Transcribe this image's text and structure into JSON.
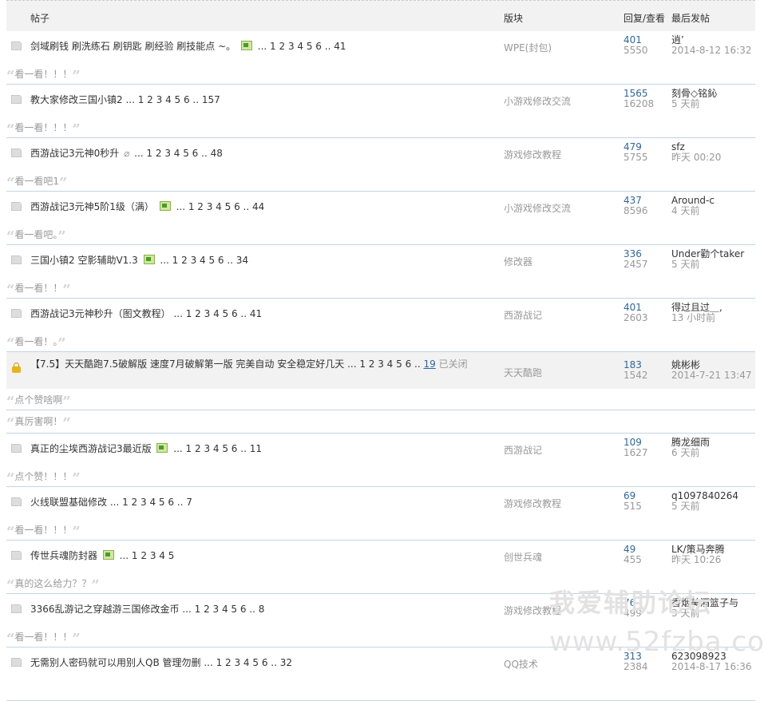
{
  "header": {
    "col_topic": "帖子",
    "col_forum": "版块",
    "col_stats": "回复/查看",
    "col_last": "最后发帖"
  },
  "threads": [
    {
      "title": "剑域刷钱 刷洗练石 刷钥匙 刷经验 刷技能点 ~。",
      "pic": true,
      "pages": "... 1 2 3 4 5 6 .. 41",
      "forum": "WPE(封包)",
      "replies": "401",
      "views": "5550",
      "last_user": "逍’",
      "last_time": "2014-8-12 16:32",
      "quote": "看一看！！！"
    },
    {
      "title": "教大家修改三国小镇2",
      "pages": "... 1 2 3 4 5 6 .. 157",
      "forum": "小游戏修改交流",
      "replies": "1565",
      "views": "16208",
      "last_user": "刻骨◇铭鈊",
      "last_time": "5 天前",
      "quote": "看一看！！！"
    },
    {
      "title": "西游战记3元神0秒升",
      "clip": true,
      "pages": "... 1 2 3 4 5 6 .. 48",
      "forum": "游戏修改教程",
      "replies": "479",
      "views": "5755",
      "last_user": "sfz",
      "last_time": "昨天 00:20",
      "quote": "看一看吧1"
    },
    {
      "title": "西游战记3元神5阶1级（满）",
      "pic": true,
      "pages": "... 1 2 3 4 5 6 .. 44",
      "forum": "小游戏修改交流",
      "replies": "437",
      "views": "8596",
      "last_user": "Around-c",
      "last_time": "4 天前",
      "quote": "看一看吧。"
    },
    {
      "title": "三国小镇2 空影辅助V1.3",
      "pic": true,
      "pages": "... 1 2 3 4 5 6 .. 34",
      "forum": "修改器",
      "replies": "336",
      "views": "2457",
      "last_user": "Under勸个taker",
      "last_time": "5 天前",
      "quote": "看一看！！"
    },
    {
      "title": "西游战记3元神秒升（图文教程）",
      "pages": "... 1 2 3 4 5 6 .. 41",
      "forum": "西游战记",
      "replies": "401",
      "views": "2603",
      "last_user": "得过且过＿,",
      "last_time": "13 小时前",
      "quote": "看一看！。"
    }
  ],
  "locked_thread": {
    "title": "【7.5】天天酷跑7.5破解版 速度7月破解第一版 完美自动 安全稳定好几天",
    "pages": "... 1 2 3 4 5 6 ..",
    "last_page": "19",
    "closed": "已关闭",
    "forum": "天天酷跑",
    "replies": "183",
    "views": "1542",
    "last_user": "姚彬彬",
    "last_time": "2014-7-21 13:47",
    "quote": "点个赞啥啊",
    "quote2": "真厉害啊！"
  },
  "threads2": [
    {
      "title": "真正的尘埃西游战记3最近版",
      "pic": true,
      "pages": "... 1 2 3 4 5 6 .. 11",
      "forum": "西游战记",
      "replies": "109",
      "views": "1627",
      "last_user": "腾龙细雨",
      "last_time": "6 天前",
      "quote": "点个赞！！！"
    },
    {
      "title": "火线联盟基础修改",
      "pages": "... 1 2 3 4 5 6 .. 7",
      "forum": "游戏修改教程",
      "replies": "69",
      "views": "515",
      "last_user": "q1097840264",
      "last_time": "5 天前",
      "quote": "看一看！！！"
    },
    {
      "title": "传世兵魂防封器",
      "pic": true,
      "pages": "... 1 2 3 4 5",
      "forum": "创世兵魂",
      "replies": "49",
      "views": "455",
      "last_user": "LK/策马奔腾",
      "last_time": "昨天 10:26",
      "quote": "真的这么给力？？"
    },
    {
      "title": "3366乱游记之穿越游三国修改金币",
      "pages": "... 1 2 3 4 5 6 .. 8",
      "forum": "游戏修改教程",
      "replies": "76",
      "views": "499",
      "last_user": "香烟美酒篮子与",
      "last_time": "3 天前",
      "quote": "看一看！！！"
    },
    {
      "title": "无需别人密码就可以用别人QB 管理勿删",
      "pages": "... 1 2 3 4 5 6 .. 32",
      "forum": "QQ技术",
      "replies": "313",
      "views": "2384",
      "last_user": "623098923",
      "last_time": "2014-8-17 16:36",
      "quote": ""
    }
  ],
  "watermark": {
    "line1": "我爱辅助论坛",
    "line2": "www.52fzba.com"
  }
}
